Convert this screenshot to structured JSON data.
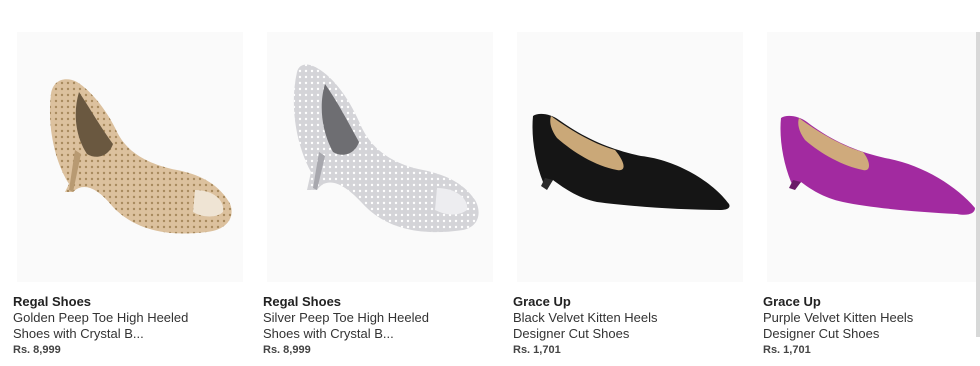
{
  "products": [
    {
      "brand": "Regal Shoes",
      "title_line1": "Golden Peep Toe High Heeled",
      "title_line2": "Shoes with Crystal B...",
      "price": "Rs. 8,999",
      "image": "golden-peep-toe-heel",
      "color": "#d6b994"
    },
    {
      "brand": "Regal Shoes",
      "title_line1": "Silver Peep Toe High Heeled",
      "title_line2": "Shoes with Crystal B...",
      "price": "Rs. 8,999",
      "image": "silver-peep-toe-heel",
      "color": "#d6d6da"
    },
    {
      "brand": "Grace Up",
      "title_line1": "Black Velvet Kitten Heels",
      "title_line2": "Designer Cut Shoes",
      "price": "Rs. 1,701",
      "image": "black-kitten-heel",
      "color": "#151515"
    },
    {
      "brand": "Grace Up",
      "title_line1": "Purple Velvet Kitten Heels",
      "title_line2": "Designer Cut Shoes",
      "price": "Rs. 1,701",
      "image": "purple-kitten-heel",
      "color": "#a22aa0"
    }
  ]
}
